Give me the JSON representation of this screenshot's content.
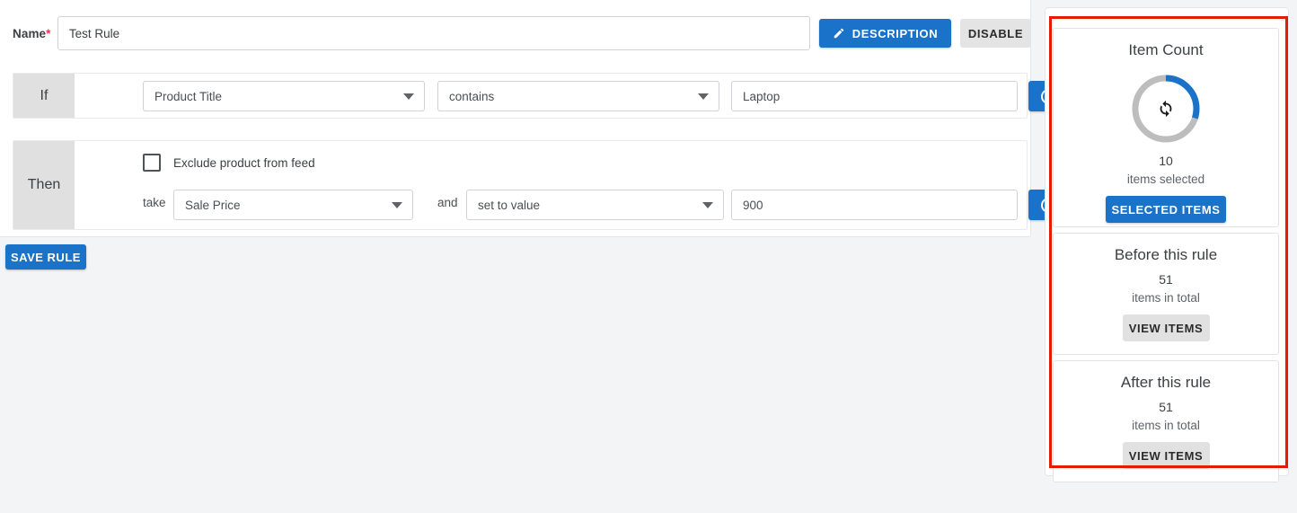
{
  "colors": {
    "primary_blue": "#1a73c8",
    "highlight_red": "#e51b00",
    "label_gray": "#e0e0e0",
    "donut_track": "#bdbdbd",
    "donut_arc": "#1a73c8",
    "page_background": "#f2f4f6"
  },
  "form": {
    "name_label": "Name",
    "name_required_marker": "*",
    "name_value": "Test Rule",
    "name_placeholder": "Name",
    "description_button": "DESCRIPTION",
    "description_icon": "pencil-icon",
    "disable_button": "DISABLE",
    "save_button": "SAVE RULE"
  },
  "if_block": {
    "label": "If",
    "attribute_select": "Product Title",
    "operator_select": "contains",
    "value_input": "Laptop",
    "value_placeholder": "Value",
    "add_button_icon": "circle-plus-icon",
    "add_button_caret": "chevron-down-icon"
  },
  "then_block": {
    "label": "Then",
    "exclude_checkbox_label": "Exclude product from feed",
    "exclude_checkbox_checked": false,
    "take_label": "take",
    "field_select": "Sale Price",
    "and_label": "and",
    "operation_select": "set to value",
    "value_input": "900",
    "value_placeholder": "Value",
    "add_button_icon": "circle-plus-icon",
    "add_button_caret": "chevron-down-icon"
  },
  "stats": {
    "item_count": {
      "title": "Item Count",
      "center_icon": "refresh-sync-icon",
      "count": "10",
      "subtitle": "items selected",
      "button": "SELECTED ITEMS",
      "arc_percent": 30
    },
    "before_rule": {
      "title": "Before this rule",
      "count": "51",
      "subtitle": "items in total",
      "button": "VIEW ITEMS"
    },
    "after_rule": {
      "title": "After this rule",
      "count": "51",
      "subtitle": "items in total",
      "button": "VIEW ITEMS"
    }
  }
}
